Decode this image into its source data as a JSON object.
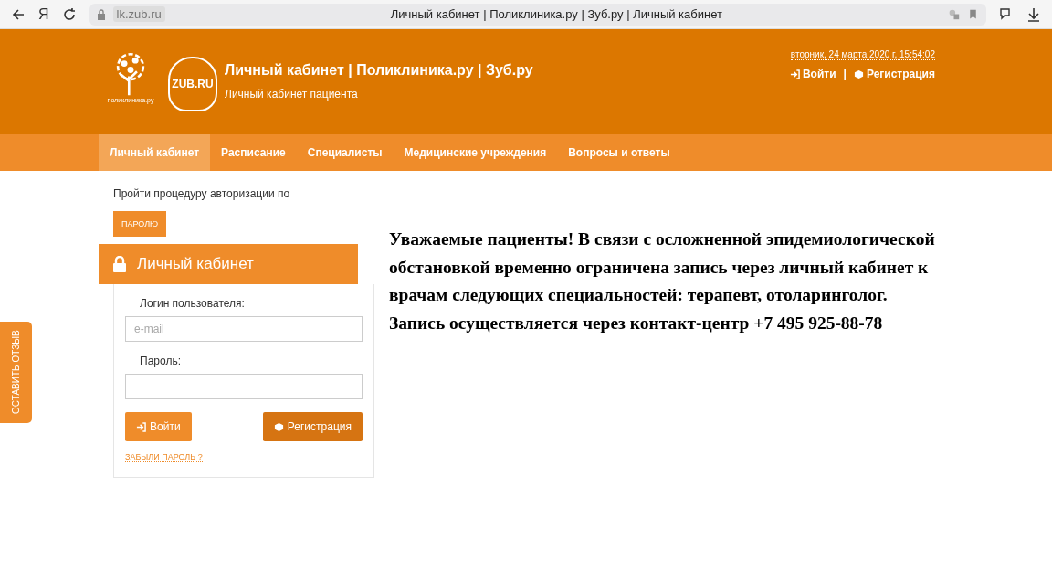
{
  "browser": {
    "domain": "lk.zub.ru",
    "title": "Личный кабинет | Поликлиника.ру | Зуб.ру | Личный кабинет",
    "yandex_glyph": "Я"
  },
  "header": {
    "logo_caption": "поликлиника.ру",
    "zub_logo": "ZUB.RU",
    "title": "Личный кабинет | Поликлиника.ру | Зуб.ру",
    "subtitle": "Личный кабинет пациента",
    "datetime": "вторник, 24 марта 2020 г, 15:54:02",
    "login": "Войти",
    "separator": "|",
    "register": "Регистрация"
  },
  "nav": [
    {
      "label": "Личный кабинет",
      "selected": true
    },
    {
      "label": "Расписание",
      "selected": false
    },
    {
      "label": "Специалисты",
      "selected": false
    },
    {
      "label": "Медицинские учреждения",
      "selected": false
    },
    {
      "label": "Вопросы и ответы",
      "selected": false
    }
  ],
  "auth": {
    "intro": "Пройти процедуру авторизации по",
    "tabs": [
      {
        "label": "ПАРОЛЮ",
        "selected": true
      }
    ],
    "panel_title": "Личный кабинет",
    "login_label": "Логин пользователя:",
    "login_placeholder": "e-mail",
    "password_label": "Пароль:",
    "login_button": "Войти",
    "register_button": "Регистрация",
    "forgot": "ЗАБЫЛИ ПАРОЛЬ ?"
  },
  "notice": [
    "Уважаемые пациенты! В связи с осложненной эпидемиологической обстановкой временно ограничена запись через личный кабинет к врачам следующих специальностей: терапевт, отоларинголог.",
    "Запись осуществляется через контакт-центр +7 495 925-88-78"
  ],
  "feedback": "ОСТАВИТЬ ОТЗЫВ"
}
